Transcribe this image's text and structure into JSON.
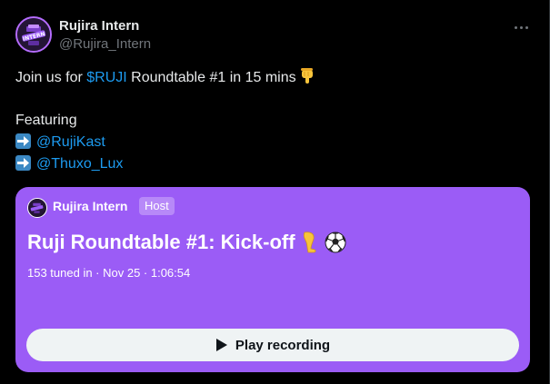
{
  "author": {
    "name": "Rujira Intern",
    "handle": "@Rujira_Intern",
    "avatar_text": "INTERN"
  },
  "tweet": {
    "line1_prefix": "Join us for ",
    "cashtag": "$RUJI",
    "line1_suffix": " Roundtable #1 in 15 mins",
    "line1_emoji": "backhand-index-pointing-down",
    "line2": "Featuring",
    "mentions": [
      "@RujiKast",
      "@Thuxo_Lux"
    ],
    "mention_emoji": "right-arrow-emoji"
  },
  "space": {
    "host_name": "Rujira Intern",
    "host_badge": "Host",
    "title": "Ruji Roundtable #1: Kick-off",
    "title_emojis": [
      "leg-icon",
      "soccer-ball-icon"
    ],
    "meta": "153 tuned in · Nov 25 · 1:06:54",
    "play_label": "Play recording",
    "card_color": "#9b5cf6"
  },
  "colors": {
    "background": "#000000",
    "text": "#e7e9ea",
    "secondary": "#71767b",
    "link": "#1d9bf0"
  }
}
